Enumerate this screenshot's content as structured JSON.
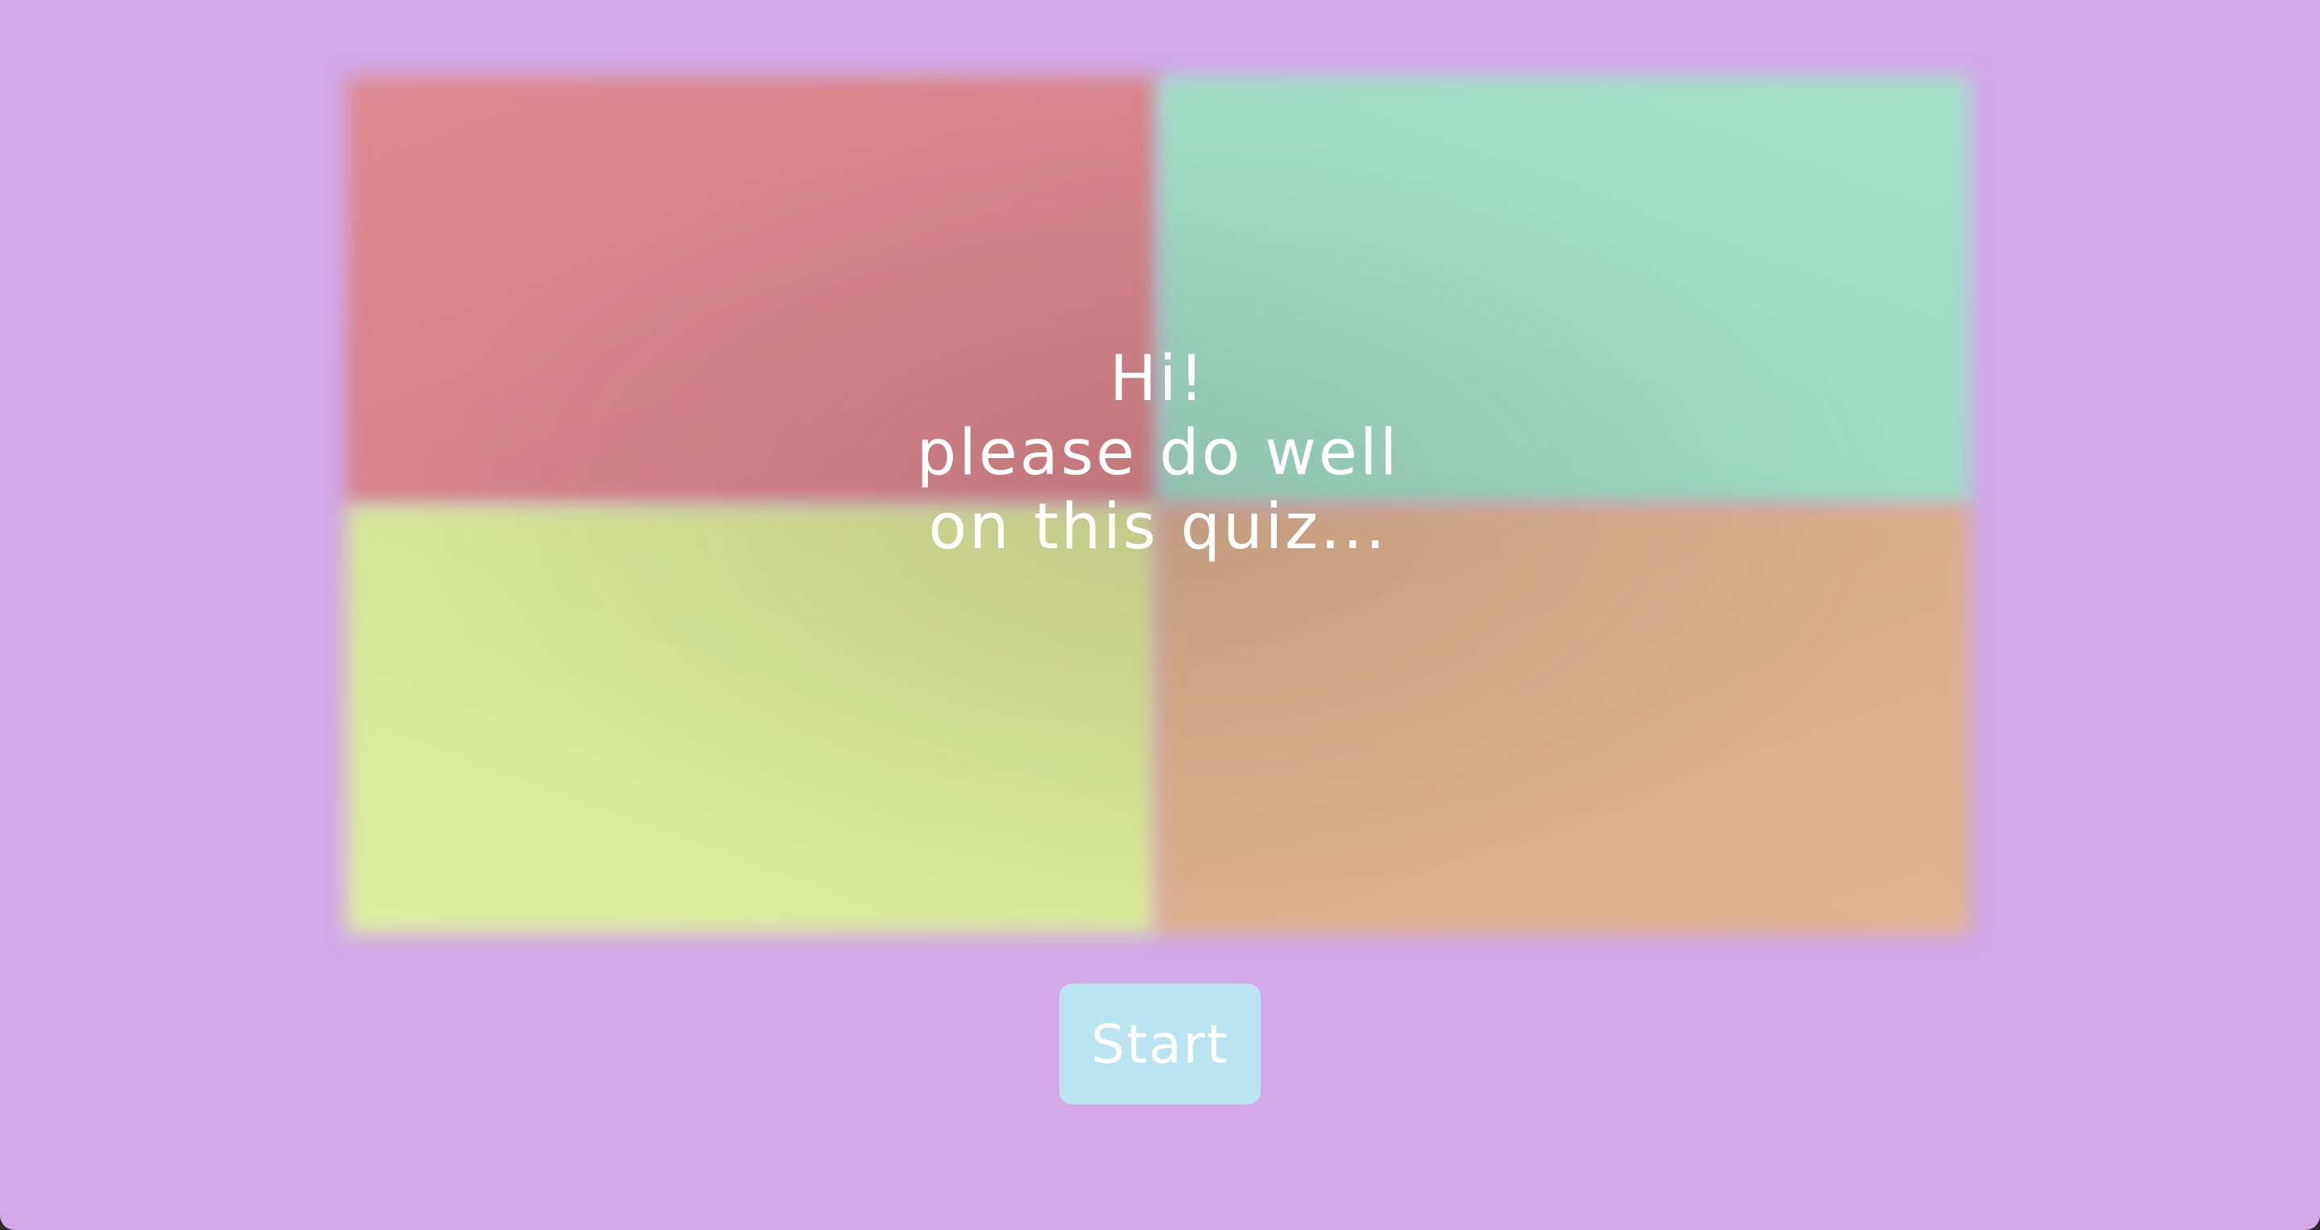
{
  "colors": {
    "background": "#d3a9e8",
    "tile_red": "#dc8b8e",
    "tile_green": "#a5e3cb",
    "tile_yellow": "#dceea0",
    "tile_orange": "#e0b58f",
    "button_background": "#bbe4f2",
    "text": "#ffffff"
  },
  "hero": {
    "lines": [
      "Hi!",
      "please do well",
      "on this quiz..."
    ]
  },
  "start_button": {
    "label": "Start"
  }
}
